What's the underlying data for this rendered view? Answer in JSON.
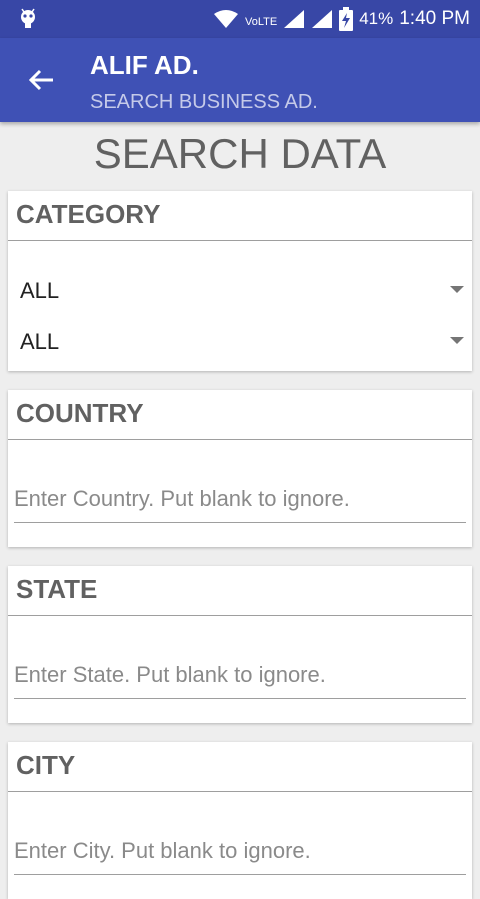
{
  "status": {
    "network": "VoLTE",
    "battery": "41%",
    "time": "1:40 PM"
  },
  "appbar": {
    "title": "ALIF AD.",
    "subtitle": "SEARCH BUSINESS AD."
  },
  "page_title": "SEARCH DATA",
  "category": {
    "heading": "CATEGORY",
    "selects": [
      "ALL",
      "ALL"
    ]
  },
  "country": {
    "heading": "COUNTRY",
    "placeholder": "Enter Country. Put blank to ignore."
  },
  "state": {
    "heading": "STATE",
    "placeholder": "Enter State. Put blank to ignore."
  },
  "city": {
    "heading": "CITY",
    "placeholder": "Enter City. Put blank to ignore."
  }
}
